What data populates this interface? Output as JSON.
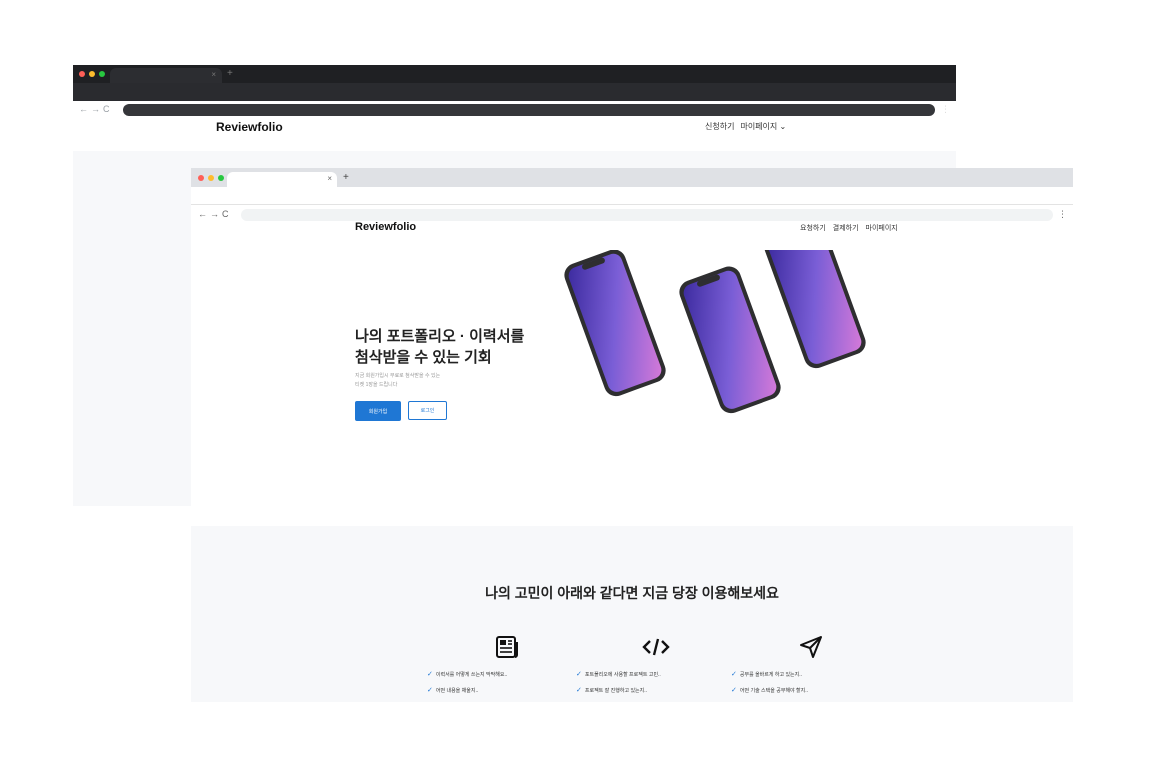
{
  "back_window": {
    "brand": "Reviewfolio",
    "nav": {
      "apply": "신청하기",
      "mypage": "마이페이지"
    }
  },
  "front_window": {
    "brand": "Reviewfolio",
    "nav": {
      "request": "요청하기",
      "pay": "결제하기",
      "mypage": "마이페이지"
    },
    "hero": {
      "title_line1": "나의 포트폴리오 · 이력서를",
      "title_line2": "첨삭받을 수 있는 기회",
      "subtitle_line1": "지금 회원가입시 무료로 첨삭받을 수 있는",
      "subtitle_line2": "티켓 1장을 드립니다",
      "signup_label": "회원가입",
      "login_label": "로그인"
    },
    "section": {
      "title": "나의 고민이 아래와 같다면 지금 당장 이용해보세요",
      "features": [
        {
          "icon": "newspaper-icon",
          "items": [
            "이력서를 어떻게 쓰는지 막막해요..",
            "어떤 내용을 채울지.."
          ]
        },
        {
          "icon": "code-icon",
          "items": [
            "포트폴리오에 사용할 프로젝트 고민..",
            "프로젝트 잘 진행하고 있는지.."
          ]
        },
        {
          "icon": "paper-plane-icon",
          "items": [
            "공부를 올바르게 하고 있는지..",
            "어떤 기술 스택을 공부해야 할지.."
          ]
        }
      ]
    }
  },
  "colors": {
    "primary": "#1f77d4",
    "phone_gradient_start": "#3b2a9e",
    "phone_gradient_end": "#d77ad9"
  }
}
